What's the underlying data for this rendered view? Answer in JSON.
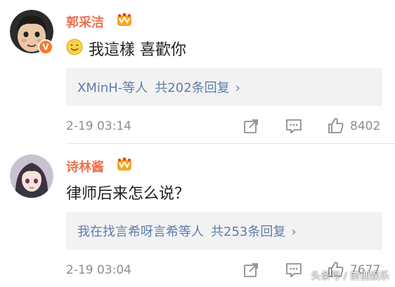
{
  "comments": [
    {
      "username": "郭采洁",
      "text": "我這樣 喜歡你",
      "reply_summary": "XMinH-等人",
      "reply_count": "共202条回复",
      "time": "2-19 03:14",
      "likes": "8402"
    },
    {
      "username": "诗林酱",
      "text": "律师后来怎么说？",
      "reply_summary": "我在找言希呀言希等人",
      "reply_count": "共253条回复",
      "time": "2-19 03:04",
      "likes": "7677"
    }
  ],
  "watermark": "头条号 / 前创娱乐",
  "colors": {
    "username": "#eb7350",
    "link": "#5d7dab",
    "meta": "#8e8e8e",
    "reply_bg": "#f2f2f2"
  },
  "icons": [
    "verified-v-icon",
    "vip-crown-icon",
    "smile-emoji-icon",
    "forward-icon",
    "comment-icon",
    "like-icon",
    "chevron-right-icon"
  ]
}
